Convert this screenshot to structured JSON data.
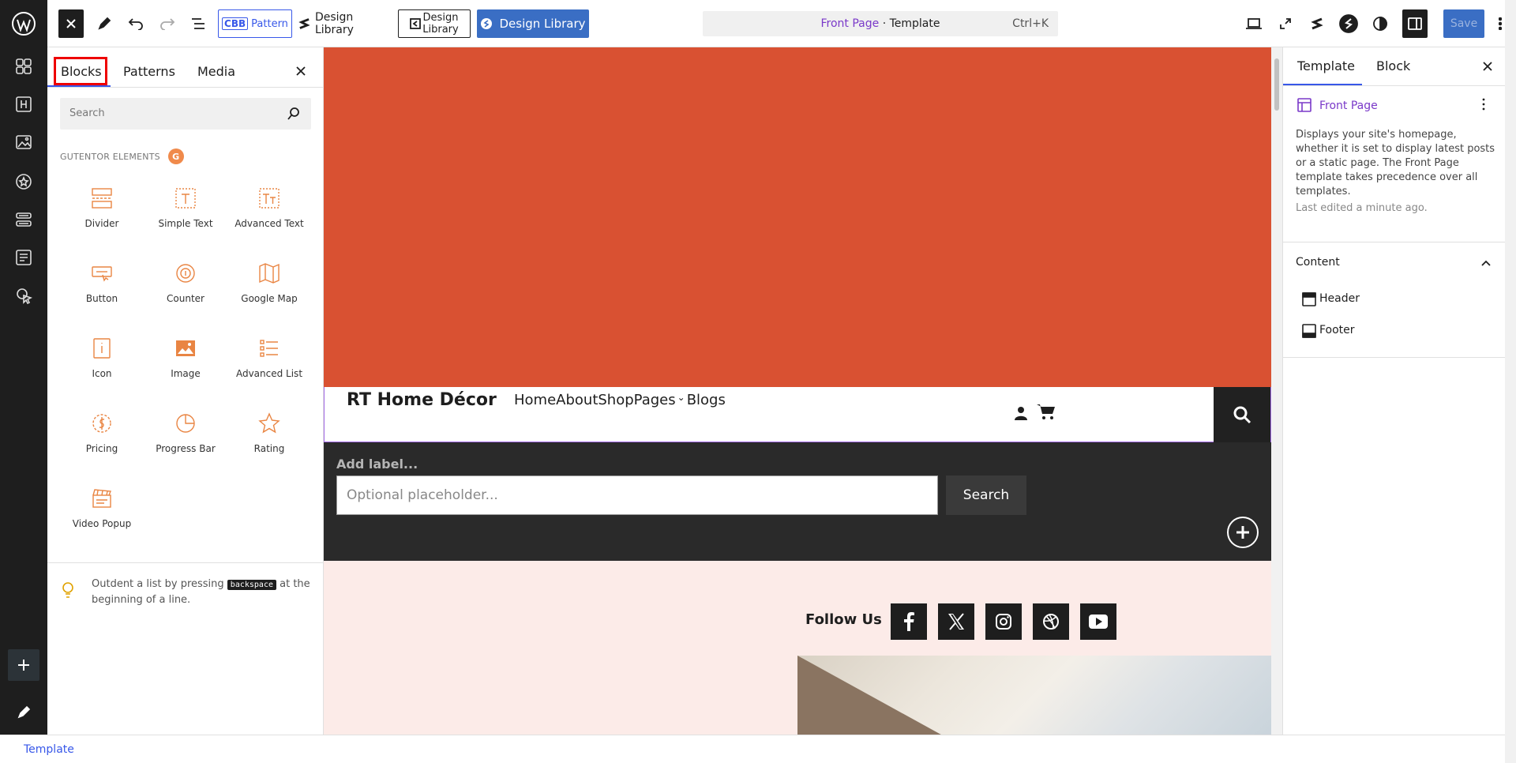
{
  "topbar": {
    "pattern_label": "Pattern",
    "pattern_badge": "CBB",
    "design_library_1": "Design Library",
    "design_library_2_line1": "Design",
    "design_library_2_line2": "Library",
    "design_library_3": "Design Library",
    "command": {
      "highlight": "Front Page",
      "sep": " · ",
      "rest": "Template",
      "shortcut": "Ctrl+K"
    },
    "save_label": "Save"
  },
  "inserter": {
    "tabs": [
      "Blocks",
      "Patterns",
      "Media"
    ],
    "search_placeholder": "Search",
    "category": "GUTENTOR ELEMENTS",
    "category_logo": "G",
    "blocks": [
      "Divider",
      "Simple Text",
      "Advanced Text",
      "Button",
      "Counter",
      "Google Map",
      "Icon",
      "Image",
      "Advanced List",
      "Pricing",
      "Progress Bar",
      "Rating",
      "Video Popup"
    ],
    "tip_before": "Outdent a list by pressing",
    "tip_key": "backspace",
    "tip_after": "at the beginning of a line."
  },
  "canvas": {
    "site_title": "RT Home Décor",
    "nav": [
      "Home",
      "About",
      "Shop",
      "Pages",
      "Blogs"
    ],
    "search_label": "Add label...",
    "search_placeholder": "Optional placeholder...",
    "search_button": "Search",
    "follow_us": "Follow Us"
  },
  "settings": {
    "tabs": [
      "Template",
      "Block"
    ],
    "template_name": "Front Page",
    "description": "Displays your site's homepage, whether it is set to display latest posts or a static page. The Front Page template takes precedence over all templates.",
    "last_edited": "Last edited a minute ago.",
    "content_heading": "Content",
    "parts": [
      "Header",
      "Footer"
    ]
  },
  "footer": {
    "breadcrumb": "Template"
  },
  "colors": {
    "accent": "#3858e9",
    "hero": "#d95132",
    "dark_section": "#2a2a2a",
    "pink_section": "#fcebe8",
    "gutentor": "#e98543"
  }
}
